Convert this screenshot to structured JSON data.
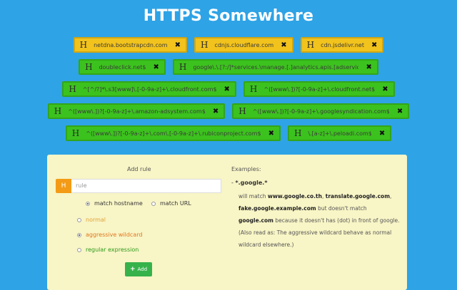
{
  "title": "HTTPS Somewhere",
  "tags": [
    {
      "text": "netdna.bootstrapcdn.com",
      "color": "yellow"
    },
    {
      "text": "cdnjs.cloudflare.com",
      "color": "yellow"
    },
    {
      "text": "cdn.jsdelivr.net",
      "color": "yellow"
    },
    {
      "text": "doubleclick.net$",
      "color": "green"
    },
    {
      "text": "google\\.\\.[?:/]*services.\\manage.[.]analytics.apis.[adservices].com$",
      "color": "green"
    },
    {
      "text": "^[^/?]*\\.s3[www]\\.[-0-9a-z]+\\.cloudfront.com$",
      "color": "green"
    },
    {
      "text": "^([www\\.])?[-0-9a-z]+\\.cloudfront.net$",
      "color": "green"
    },
    {
      "text": "^([www\\.])?[-0-9a-z]+\\.amazon-adsystem.com$",
      "color": "green"
    },
    {
      "text": "^([www\\.])?[-0-9a-z]+\\.googlesyndication.com$",
      "color": "green"
    },
    {
      "text": "^([www\\.])?[-0-9a-z]+\\.com\\.[-0-9a-z]+\\.rubiconproject.com$",
      "color": "green"
    },
    {
      "text": "\\.[a-z]+\\.peloadi.com$",
      "color": "green"
    }
  ],
  "rule": {
    "add_rule_label": "Add rule",
    "input_placeholder": "rule",
    "icon": "H",
    "match_hostname": "match hostname",
    "match_url": "match URL",
    "normal": "normal",
    "aggressive": "aggressive wildcard",
    "regex": "regular expression",
    "add_button": "Add"
  },
  "examples": {
    "title": "Examples:",
    "pattern_prefix": "- ",
    "pattern": "*.google.*",
    "will_match": "will match",
    "m1": "www.google.co.th",
    "m2": "translate.google.com",
    "m3": "fake.google.example.com",
    "but_not": "but doesn't match",
    "m4": "google.com",
    "reason": "because it doesn't has (dot) in front of google.",
    "note": "(Also read as: The aggressive wildcard behave as normal wildcard elsewhere.)"
  },
  "colors": {
    "background": "#2ea3e6",
    "tag_yellow": "#f2c31c",
    "tag_green": "#3cc21e",
    "panel": "#f8f5c6",
    "add_button": "#36b24b"
  }
}
